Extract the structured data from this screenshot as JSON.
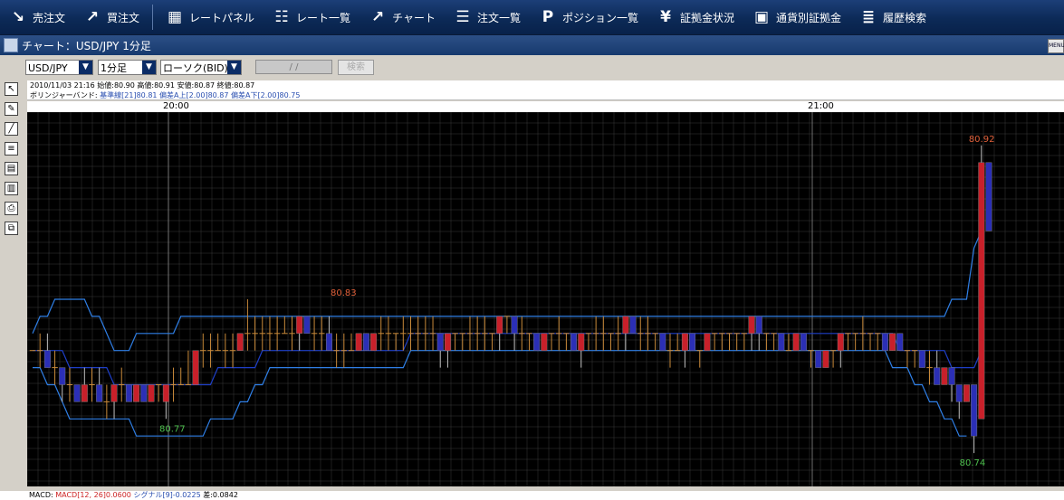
{
  "toolbar": {
    "items": [
      {
        "label": "売注文",
        "icon": "arrow-down-right-icon"
      },
      {
        "label": "買注文",
        "icon": "arrow-up-right-icon"
      },
      {
        "label": "レートパネル",
        "icon": "rate-panel-icon"
      },
      {
        "label": "レート一覧",
        "icon": "rate-list-icon"
      },
      {
        "label": "チャート",
        "icon": "chart-icon"
      },
      {
        "label": "注文一覧",
        "icon": "order-list-icon"
      },
      {
        "label": "ポジション一覧",
        "icon": "position-p-icon"
      },
      {
        "label": "証拠金状況",
        "icon": "yen-icon"
      },
      {
        "label": "通貨別証拠金",
        "icon": "currency-margin-icon"
      },
      {
        "label": "履歴検索",
        "icon": "history-search-icon"
      }
    ]
  },
  "window": {
    "title": "チャート：USD/JPY 1分足",
    "menu_label": "MENU"
  },
  "controls": {
    "pair": "USD/JPY",
    "timeframe": "1分足",
    "chart_type": "ローソク(BID)",
    "date_placeholder": "/ /",
    "search_label": "検索"
  },
  "info": {
    "ohlc_line": "2010/11/03 21:16  始値:80.90  高値:80.91  安値:80.87  終値:80.87",
    "bb_label": "ボリンジャーバンド:",
    "bb_mid": "基準線[21]80.81",
    "bb_upper": "偏差A上[2.00]80.87",
    "bb_lower": "偏差A下[2.00]80.75"
  },
  "time_axis": [
    "20:00",
    "21:00"
  ],
  "annotations": {
    "high_label": "80.92",
    "mid_high_label": "80.83",
    "low_label": "80.77",
    "bottom_label": "80.74"
  },
  "macd": {
    "label": "MACD:",
    "values": "MACD[12, 26]0.0600",
    "signal": "シグナル[9]-0.0225",
    "hist": "差:0.0842"
  },
  "colors": {
    "bull": "#c8202a",
    "bear": "#2b2fb6",
    "band": "#2f7fe6",
    "mid_band": "#1e3fc8",
    "doji": "#c98a3a",
    "grid": "#3a3a3a"
  },
  "chart_data": {
    "type": "candlestick",
    "ylim": [
      80.73,
      80.93
    ],
    "candles": [
      {
        "o": 80.8,
        "h": 80.8,
        "l": 80.8,
        "c": 80.8
      },
      {
        "o": 80.8,
        "h": 80.81,
        "l": 80.79,
        "c": 80.8
      },
      {
        "o": 80.8,
        "h": 80.81,
        "l": 80.79,
        "c": 80.79
      },
      {
        "o": 80.79,
        "h": 80.8,
        "l": 80.78,
        "c": 80.79
      },
      {
        "o": 80.79,
        "h": 80.79,
        "l": 80.77,
        "c": 80.78
      },
      {
        "o": 80.78,
        "h": 80.79,
        "l": 80.77,
        "c": 80.78
      },
      {
        "o": 80.78,
        "h": 80.78,
        "l": 80.77,
        "c": 80.77
      },
      {
        "o": 80.77,
        "h": 80.79,
        "l": 80.77,
        "c": 80.78
      },
      {
        "o": 80.78,
        "h": 80.79,
        "l": 80.77,
        "c": 80.78
      },
      {
        "o": 80.78,
        "h": 80.79,
        "l": 80.77,
        "c": 80.77
      },
      {
        "o": 80.77,
        "h": 80.78,
        "l": 80.76,
        "c": 80.77
      },
      {
        "o": 80.77,
        "h": 80.78,
        "l": 80.76,
        "c": 80.78
      },
      {
        "o": 80.78,
        "h": 80.79,
        "l": 80.77,
        "c": 80.78
      },
      {
        "o": 80.78,
        "h": 80.78,
        "l": 80.77,
        "c": 80.77
      },
      {
        "o": 80.77,
        "h": 80.78,
        "l": 80.77,
        "c": 80.78
      },
      {
        "o": 80.78,
        "h": 80.78,
        "l": 80.77,
        "c": 80.77
      },
      {
        "o": 80.77,
        "h": 80.78,
        "l": 80.77,
        "c": 80.78
      },
      {
        "o": 80.78,
        "h": 80.78,
        "l": 80.77,
        "c": 80.78
      },
      {
        "o": 80.77,
        "h": 80.78,
        "l": 80.76,
        "c": 80.78
      },
      {
        "o": 80.78,
        "h": 80.79,
        "l": 80.77,
        "c": 80.78
      },
      {
        "o": 80.78,
        "h": 80.79,
        "l": 80.78,
        "c": 80.78
      },
      {
        "o": 80.78,
        "h": 80.8,
        "l": 80.78,
        "c": 80.78
      },
      {
        "o": 80.78,
        "h": 80.8,
        "l": 80.78,
        "c": 80.8
      },
      {
        "o": 80.8,
        "h": 80.81,
        "l": 80.79,
        "c": 80.8
      },
      {
        "o": 80.8,
        "h": 80.81,
        "l": 80.79,
        "c": 80.8
      },
      {
        "o": 80.8,
        "h": 80.81,
        "l": 80.8,
        "c": 80.8
      },
      {
        "o": 80.8,
        "h": 80.81,
        "l": 80.79,
        "c": 80.8
      },
      {
        "o": 80.8,
        "h": 80.81,
        "l": 80.79,
        "c": 80.8
      },
      {
        "o": 80.8,
        "h": 80.81,
        "l": 80.8,
        "c": 80.81
      },
      {
        "o": 80.81,
        "h": 80.83,
        "l": 80.8,
        "c": 80.81
      },
      {
        "o": 80.81,
        "h": 80.82,
        "l": 80.8,
        "c": 80.81
      },
      {
        "o": 80.81,
        "h": 80.82,
        "l": 80.8,
        "c": 80.81
      },
      {
        "o": 80.81,
        "h": 80.82,
        "l": 80.8,
        "c": 80.81
      },
      {
        "o": 80.81,
        "h": 80.82,
        "l": 80.8,
        "c": 80.81
      },
      {
        "o": 80.81,
        "h": 80.82,
        "l": 80.81,
        "c": 80.81
      },
      {
        "o": 80.81,
        "h": 80.82,
        "l": 80.8,
        "c": 80.81
      },
      {
        "o": 80.81,
        "h": 80.82,
        "l": 80.8,
        "c": 80.82
      },
      {
        "o": 80.82,
        "h": 80.82,
        "l": 80.81,
        "c": 80.81
      },
      {
        "o": 80.81,
        "h": 80.82,
        "l": 80.8,
        "c": 80.81
      },
      {
        "o": 80.81,
        "h": 80.82,
        "l": 80.8,
        "c": 80.81
      },
      {
        "o": 80.81,
        "h": 80.82,
        "l": 80.8,
        "c": 80.8
      },
      {
        "o": 80.8,
        "h": 80.81,
        "l": 80.79,
        "c": 80.8
      },
      {
        "o": 80.8,
        "h": 80.81,
        "l": 80.79,
        "c": 80.8
      },
      {
        "o": 80.8,
        "h": 80.81,
        "l": 80.8,
        "c": 80.8
      },
      {
        "o": 80.8,
        "h": 80.81,
        "l": 80.8,
        "c": 80.81
      },
      {
        "o": 80.81,
        "h": 80.81,
        "l": 80.8,
        "c": 80.8
      },
      {
        "o": 80.8,
        "h": 80.81,
        "l": 80.8,
        "c": 80.81
      },
      {
        "o": 80.81,
        "h": 80.82,
        "l": 80.8,
        "c": 80.81
      },
      {
        "o": 80.81,
        "h": 80.82,
        "l": 80.8,
        "c": 80.81
      },
      {
        "o": 80.81,
        "h": 80.81,
        "l": 80.8,
        "c": 80.81
      },
      {
        "o": 80.81,
        "h": 80.82,
        "l": 80.8,
        "c": 80.81
      },
      {
        "o": 80.81,
        "h": 80.82,
        "l": 80.8,
        "c": 80.81
      },
      {
        "o": 80.81,
        "h": 80.82,
        "l": 80.8,
        "c": 80.81
      },
      {
        "o": 80.81,
        "h": 80.82,
        "l": 80.8,
        "c": 80.81
      },
      {
        "o": 80.81,
        "h": 80.82,
        "l": 80.8,
        "c": 80.81
      },
      {
        "o": 80.81,
        "h": 80.81,
        "l": 80.79,
        "c": 80.8
      },
      {
        "o": 80.8,
        "h": 80.81,
        "l": 80.79,
        "c": 80.81
      },
      {
        "o": 80.81,
        "h": 80.81,
        "l": 80.8,
        "c": 80.81
      },
      {
        "o": 80.81,
        "h": 80.81,
        "l": 80.8,
        "c": 80.81
      },
      {
        "o": 80.81,
        "h": 80.82,
        "l": 80.8,
        "c": 80.81
      },
      {
        "o": 80.81,
        "h": 80.82,
        "l": 80.8,
        "c": 80.81
      },
      {
        "o": 80.81,
        "h": 80.82,
        "l": 80.8,
        "c": 80.81
      },
      {
        "o": 80.81,
        "h": 80.81,
        "l": 80.8,
        "c": 80.81
      },
      {
        "o": 80.81,
        "h": 80.82,
        "l": 80.8,
        "c": 80.82
      },
      {
        "o": 80.82,
        "h": 80.82,
        "l": 80.81,
        "c": 80.82
      },
      {
        "o": 80.82,
        "h": 80.82,
        "l": 80.8,
        "c": 80.81
      },
      {
        "o": 80.81,
        "h": 80.82,
        "l": 80.8,
        "c": 80.81
      },
      {
        "o": 80.81,
        "h": 80.81,
        "l": 80.8,
        "c": 80.81
      },
      {
        "o": 80.81,
        "h": 80.81,
        "l": 80.8,
        "c": 80.8
      },
      {
        "o": 80.8,
        "h": 80.81,
        "l": 80.8,
        "c": 80.81
      },
      {
        "o": 80.81,
        "h": 80.81,
        "l": 80.8,
        "c": 80.81
      },
      {
        "o": 80.81,
        "h": 80.82,
        "l": 80.8,
        "c": 80.81
      },
      {
        "o": 80.81,
        "h": 80.81,
        "l": 80.8,
        "c": 80.81
      },
      {
        "o": 80.81,
        "h": 80.81,
        "l": 80.8,
        "c": 80.8
      },
      {
        "o": 80.8,
        "h": 80.81,
        "l": 80.79,
        "c": 80.81
      },
      {
        "o": 80.81,
        "h": 80.81,
        "l": 80.8,
        "c": 80.81
      },
      {
        "o": 80.81,
        "h": 80.82,
        "l": 80.8,
        "c": 80.81
      },
      {
        "o": 80.81,
        "h": 80.82,
        "l": 80.8,
        "c": 80.81
      },
      {
        "o": 80.81,
        "h": 80.81,
        "l": 80.8,
        "c": 80.81
      },
      {
        "o": 80.81,
        "h": 80.82,
        "l": 80.8,
        "c": 80.81
      },
      {
        "o": 80.81,
        "h": 80.82,
        "l": 80.8,
        "c": 80.82
      },
      {
        "o": 80.82,
        "h": 80.82,
        "l": 80.81,
        "c": 80.81
      },
      {
        "o": 80.81,
        "h": 80.82,
        "l": 80.8,
        "c": 80.81
      },
      {
        "o": 80.81,
        "h": 80.82,
        "l": 80.8,
        "c": 80.81
      },
      {
        "o": 80.81,
        "h": 80.81,
        "l": 80.8,
        "c": 80.81
      },
      {
        "o": 80.81,
        "h": 80.81,
        "l": 80.8,
        "c": 80.8
      },
      {
        "o": 80.8,
        "h": 80.81,
        "l": 80.79,
        "c": 80.8
      },
      {
        "o": 80.8,
        "h": 80.81,
        "l": 80.8,
        "c": 80.8
      },
      {
        "o": 80.8,
        "h": 80.81,
        "l": 80.79,
        "c": 80.81
      },
      {
        "o": 80.81,
        "h": 80.81,
        "l": 80.8,
        "c": 80.8
      },
      {
        "o": 80.8,
        "h": 80.8,
        "l": 80.79,
        "c": 80.8
      },
      {
        "o": 80.8,
        "h": 80.81,
        "l": 80.8,
        "c": 80.81
      },
      {
        "o": 80.81,
        "h": 80.81,
        "l": 80.8,
        "c": 80.81
      },
      {
        "o": 80.81,
        "h": 80.81,
        "l": 80.8,
        "c": 80.81
      },
      {
        "o": 80.81,
        "h": 80.81,
        "l": 80.8,
        "c": 80.81
      },
      {
        "o": 80.81,
        "h": 80.81,
        "l": 80.8,
        "c": 80.81
      },
      {
        "o": 80.81,
        "h": 80.81,
        "l": 80.8,
        "c": 80.81
      },
      {
        "o": 80.81,
        "h": 80.82,
        "l": 80.8,
        "c": 80.82
      },
      {
        "o": 80.82,
        "h": 80.82,
        "l": 80.8,
        "c": 80.81
      },
      {
        "o": 80.81,
        "h": 80.81,
        "l": 80.8,
        "c": 80.81
      },
      {
        "o": 80.81,
        "h": 80.81,
        "l": 80.8,
        "c": 80.81
      },
      {
        "o": 80.81,
        "h": 80.81,
        "l": 80.8,
        "c": 80.8
      },
      {
        "o": 80.8,
        "h": 80.81,
        "l": 80.8,
        "c": 80.8
      },
      {
        "o": 80.8,
        "h": 80.81,
        "l": 80.8,
        "c": 80.81
      },
      {
        "o": 80.81,
        "h": 80.81,
        "l": 80.8,
        "c": 80.8
      },
      {
        "o": 80.8,
        "h": 80.8,
        "l": 80.79,
        "c": 80.8
      },
      {
        "o": 80.8,
        "h": 80.8,
        "l": 80.79,
        "c": 80.79
      },
      {
        "o": 80.79,
        "h": 80.8,
        "l": 80.79,
        "c": 80.8
      },
      {
        "o": 80.8,
        "h": 80.8,
        "l": 80.79,
        "c": 80.8
      },
      {
        "o": 80.8,
        "h": 80.81,
        "l": 80.79,
        "c": 80.81
      },
      {
        "o": 80.81,
        "h": 80.81,
        "l": 80.8,
        "c": 80.81
      },
      {
        "o": 80.81,
        "h": 80.81,
        "l": 80.8,
        "c": 80.81
      },
      {
        "o": 80.81,
        "h": 80.82,
        "l": 80.8,
        "c": 80.81
      },
      {
        "o": 80.81,
        "h": 80.81,
        "l": 80.8,
        "c": 80.81
      },
      {
        "o": 80.81,
        "h": 80.81,
        "l": 80.8,
        "c": 80.81
      },
      {
        "o": 80.81,
        "h": 80.81,
        "l": 80.8,
        "c": 80.8
      },
      {
        "o": 80.8,
        "h": 80.81,
        "l": 80.8,
        "c": 80.81
      },
      {
        "o": 80.81,
        "h": 80.81,
        "l": 80.8,
        "c": 80.8
      },
      {
        "o": 80.8,
        "h": 80.8,
        "l": 80.79,
        "c": 80.8
      },
      {
        "o": 80.8,
        "h": 80.8,
        "l": 80.79,
        "c": 80.8
      },
      {
        "o": 80.8,
        "h": 80.8,
        "l": 80.79,
        "c": 80.79
      },
      {
        "o": 80.79,
        "h": 80.8,
        "l": 80.78,
        "c": 80.79
      },
      {
        "o": 80.79,
        "h": 80.8,
        "l": 80.78,
        "c": 80.78
      },
      {
        "o": 80.78,
        "h": 80.79,
        "l": 80.78,
        "c": 80.79
      },
      {
        "o": 80.79,
        "h": 80.79,
        "l": 80.77,
        "c": 80.78
      },
      {
        "o": 80.78,
        "h": 80.78,
        "l": 80.76,
        "c": 80.77
      },
      {
        "o": 80.77,
        "h": 80.78,
        "l": 80.77,
        "c": 80.78
      },
      {
        "o": 80.78,
        "h": 80.78,
        "l": 80.74,
        "c": 80.75
      },
      {
        "o": 80.76,
        "h": 80.92,
        "l": 80.76,
        "c": 80.91
      },
      {
        "o": 80.91,
        "h": 80.91,
        "l": 80.87,
        "c": 80.87
      }
    ],
    "bb_upper": [
      80.81,
      80.82,
      80.82,
      80.83,
      80.83,
      80.83,
      80.83,
      80.83,
      80.82,
      80.82,
      80.81,
      80.8,
      80.8,
      80.8,
      80.81,
      80.81,
      80.81,
      80.81,
      80.81,
      80.81,
      80.82,
      80.82,
      80.82,
      80.82,
      80.82,
      80.82,
      80.82,
      80.82,
      80.82,
      80.82,
      80.82,
      80.82,
      80.82,
      80.82,
      80.82,
      80.82,
      80.82,
      80.82,
      80.82,
      80.82,
      80.82,
      80.82,
      80.82,
      80.82,
      80.82,
      80.82,
      80.82,
      80.82,
      80.82,
      80.82,
      80.82,
      80.82,
      80.82,
      80.82,
      80.82,
      80.82,
      80.82,
      80.82,
      80.82,
      80.82,
      80.82,
      80.82,
      80.82,
      80.82,
      80.82,
      80.82,
      80.82,
      80.82,
      80.82,
      80.82,
      80.82,
      80.82,
      80.82,
      80.82,
      80.82,
      80.82,
      80.82,
      80.82,
      80.82,
      80.82,
      80.82,
      80.82,
      80.82,
      80.82,
      80.82,
      80.82,
      80.82,
      80.82,
      80.82,
      80.82,
      80.82,
      80.82,
      80.82,
      80.82,
      80.82,
      80.82,
      80.82,
      80.82,
      80.82,
      80.82,
      80.82,
      80.82,
      80.82,
      80.82,
      80.82,
      80.82,
      80.82,
      80.82,
      80.82,
      80.82,
      80.82,
      80.82,
      80.82,
      80.82,
      80.82,
      80.82,
      80.82,
      80.82,
      80.82,
      80.82,
      80.82,
      80.82,
      80.82,
      80.82,
      80.83,
      80.83,
      80.83,
      80.86,
      80.87
    ],
    "bb_lower": [
      80.79,
      80.79,
      80.78,
      80.78,
      80.77,
      80.76,
      80.76,
      80.76,
      80.76,
      80.76,
      80.76,
      80.76,
      80.76,
      80.76,
      80.75,
      80.75,
      80.75,
      80.75,
      80.75,
      80.75,
      80.75,
      80.75,
      80.75,
      80.75,
      80.76,
      80.76,
      80.76,
      80.76,
      80.77,
      80.77,
      80.78,
      80.78,
      80.79,
      80.79,
      80.79,
      80.79,
      80.79,
      80.79,
      80.79,
      80.79,
      80.79,
      80.79,
      80.79,
      80.79,
      80.79,
      80.79,
      80.79,
      80.79,
      80.79,
      80.79,
      80.79,
      80.8,
      80.8,
      80.8,
      80.8,
      80.8,
      80.8,
      80.8,
      80.8,
      80.8,
      80.8,
      80.8,
      80.8,
      80.8,
      80.8,
      80.8,
      80.8,
      80.8,
      80.8,
      80.8,
      80.8,
      80.8,
      80.8,
      80.8,
      80.8,
      80.8,
      80.8,
      80.8,
      80.8,
      80.8,
      80.8,
      80.8,
      80.8,
      80.8,
      80.8,
      80.8,
      80.8,
      80.8,
      80.8,
      80.8,
      80.8,
      80.8,
      80.8,
      80.8,
      80.8,
      80.8,
      80.8,
      80.8,
      80.8,
      80.8,
      80.8,
      80.8,
      80.8,
      80.8,
      80.8,
      80.8,
      80.8,
      80.8,
      80.8,
      80.8,
      80.8,
      80.8,
      80.8,
      80.8,
      80.8,
      80.8,
      80.79,
      80.79,
      80.79,
      80.78,
      80.78,
      80.77,
      80.77,
      80.76,
      80.76,
      80.75,
      80.75
    ],
    "bb_mid": [
      80.8,
      80.8,
      80.8,
      80.8,
      80.8,
      80.79,
      80.79,
      80.79,
      80.79,
      80.79,
      80.79,
      80.78,
      80.78,
      80.78,
      80.78,
      80.78,
      80.78,
      80.78,
      80.78,
      80.78,
      80.78,
      80.78,
      80.78,
      80.78,
      80.78,
      80.79,
      80.79,
      80.79,
      80.79,
      80.79,
      80.79,
      80.8,
      80.8,
      80.8,
      80.8,
      80.8,
      80.8,
      80.8,
      80.8,
      80.8,
      80.8,
      80.8,
      80.8,
      80.8,
      80.8,
      80.8,
      80.8,
      80.8,
      80.8,
      80.8,
      80.8,
      80.81,
      80.81,
      80.81,
      80.81,
      80.81,
      80.81,
      80.81,
      80.81,
      80.81,
      80.81,
      80.81,
      80.81,
      80.81,
      80.81,
      80.81,
      80.81,
      80.81,
      80.81,
      80.81,
      80.81,
      80.81,
      80.81,
      80.81,
      80.81,
      80.81,
      80.81,
      80.81,
      80.81,
      80.81,
      80.81,
      80.81,
      80.81,
      80.81,
      80.81,
      80.81,
      80.81,
      80.81,
      80.81,
      80.81,
      80.81,
      80.81,
      80.81,
      80.81,
      80.81,
      80.81,
      80.81,
      80.81,
      80.81,
      80.81,
      80.81,
      80.81,
      80.81,
      80.81,
      80.81,
      80.81,
      80.81,
      80.81,
      80.81,
      80.81,
      80.81,
      80.81,
      80.81,
      80.81,
      80.81,
      80.81,
      80.81,
      80.8,
      80.8,
      80.8,
      80.8,
      80.8,
      80.8,
      80.8,
      80.79,
      80.79,
      80.79,
      80.79,
      80.8
    ]
  }
}
